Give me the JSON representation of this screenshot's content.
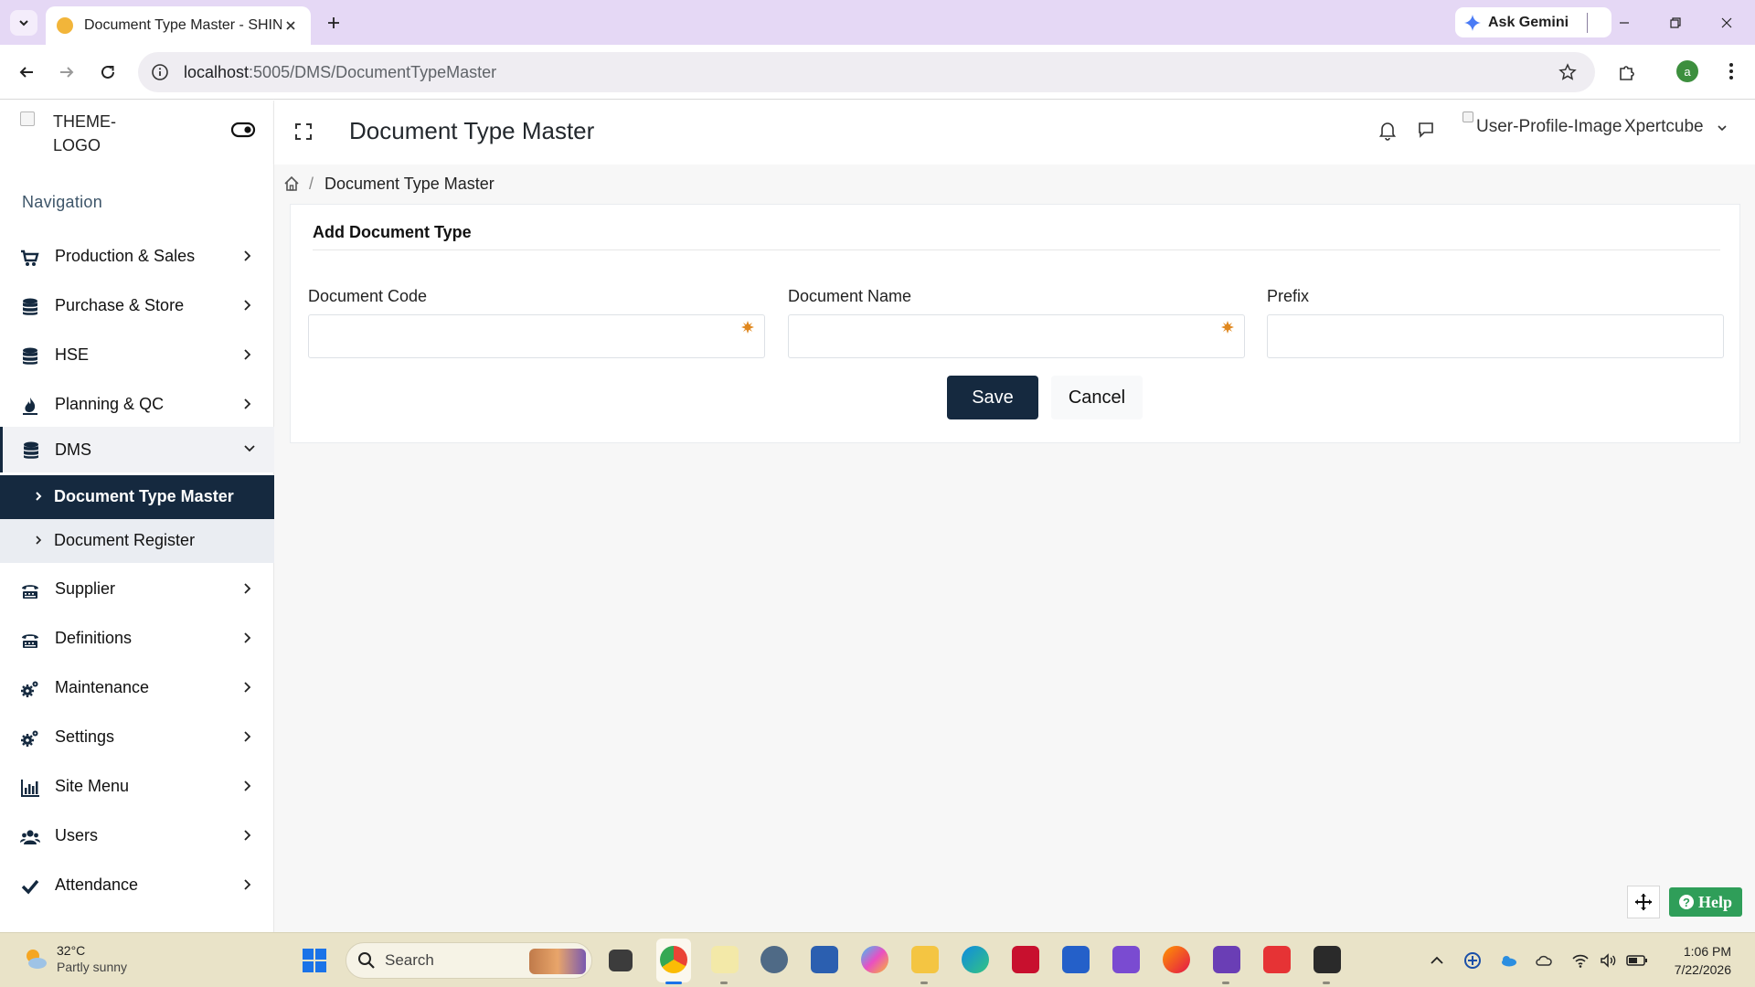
{
  "browser": {
    "tab_title": "Document Type Master - SHINE",
    "ask_gemini": "Ask Gemini",
    "url_host": "localhost",
    "url_path": ":5005/DMS/DocumentTypeMaster",
    "profile_initial": "a"
  },
  "app": {
    "logo_alt": "THEME-LOGO",
    "page_title": "Document Type Master",
    "user_image_alt": "User-Profile-Image",
    "user_name": "Xpertcube"
  },
  "sidebar": {
    "heading": "Navigation",
    "items": [
      {
        "label": "Production & Sales",
        "icon": "cart-icon"
      },
      {
        "label": "Purchase & Store",
        "icon": "database-icon"
      },
      {
        "label": "HSE",
        "icon": "database-icon"
      },
      {
        "label": "Planning & QC",
        "icon": "fire-icon"
      },
      {
        "label": "DMS",
        "icon": "database-icon",
        "expanded": true
      },
      {
        "label": "Supplier",
        "icon": "tty-icon"
      },
      {
        "label": "Definitions",
        "icon": "tty-icon"
      },
      {
        "label": "Maintenance",
        "icon": "gears-icon"
      },
      {
        "label": "Settings",
        "icon": "gears-icon"
      },
      {
        "label": "Site Menu",
        "icon": "bar-chart-icon"
      },
      {
        "label": "Users",
        "icon": "users-icon"
      },
      {
        "label": "Attendance",
        "icon": "check-icon"
      }
    ],
    "sub_items": [
      {
        "label": "Document Type Master",
        "active": true
      },
      {
        "label": "Document Register",
        "active": false
      }
    ]
  },
  "breadcrumb": {
    "current": "Document Type Master"
  },
  "form": {
    "title": "Add Document Type",
    "fields": [
      {
        "label": "Document Code",
        "value": "",
        "required_marker": true
      },
      {
        "label": "Document Name",
        "value": "",
        "required_marker": true
      },
      {
        "label": "Prefix",
        "value": "",
        "required_marker": false
      }
    ],
    "save_label": "Save",
    "cancel_label": "Cancel"
  },
  "help": {
    "label": "Help"
  },
  "taskbar": {
    "weather_temp": "32°C",
    "weather_desc": "Partly sunny",
    "search_placeholder": "Search",
    "time": "1:06 PM",
    "date": "7/22/2026"
  },
  "colors": {
    "primary": "#15293f",
    "help_green": "#2f9e59",
    "tab_strip": "#e5d8f5",
    "taskbar": "#e9e3c8"
  }
}
